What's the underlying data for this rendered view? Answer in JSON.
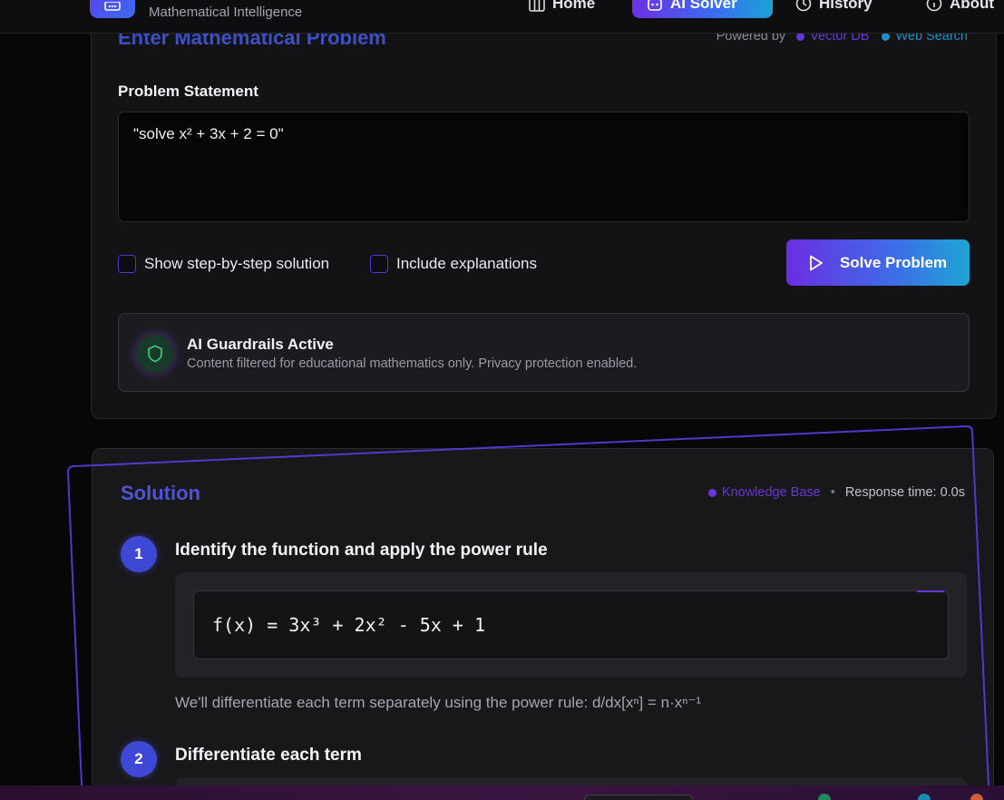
{
  "nav": {
    "brand_subtitle": "Mathematical Intelligence",
    "items": [
      {
        "label": "Home",
        "icon": "grid-icon"
      },
      {
        "label": "AI Solver",
        "icon": "robot-icon",
        "active": true
      },
      {
        "label": "History",
        "icon": "clock-icon"
      },
      {
        "label": "About",
        "icon": "info-icon"
      }
    ]
  },
  "problem": {
    "title": "Enter Mathematical Problem",
    "powered_by_label": "Powered by",
    "sources": [
      {
        "label": "Vector DB",
        "color": "#6a36d8"
      },
      {
        "label": "Web Search",
        "color": "#1f8ec2"
      }
    ],
    "field_label": "Problem Statement",
    "input_value": "\"solve x² + 3x + 2 = 0\"",
    "options": [
      {
        "label": "Show step-by-step solution",
        "checked": false
      },
      {
        "label": "Include explanations",
        "checked": false
      }
    ],
    "solve_button": "Solve Problem",
    "guardrails": {
      "title": "AI Guardrails Active",
      "text": "Content filtered for educational mathematics only. Privacy protection enabled."
    }
  },
  "solution": {
    "title": "Solution",
    "source": "Knowledge Base",
    "response_time": "Response time: 0.0s",
    "steps": [
      {
        "number": "1",
        "title": "Identify the function and apply the power rule",
        "code": "f(x) = 3x³ + 2x² - 5x + 1",
        "description": "We'll differentiate each term separately using the power rule: d/dx[xⁿ] = n·xⁿ⁻¹"
      },
      {
        "number": "2",
        "title": "Differentiate each term"
      }
    ]
  },
  "colors": {
    "accent_purple": "#6a2ee2",
    "accent_blue": "#3d6ee8",
    "accent_cyan": "#1ea5d4",
    "title_indigo": "#3f4fc4"
  }
}
